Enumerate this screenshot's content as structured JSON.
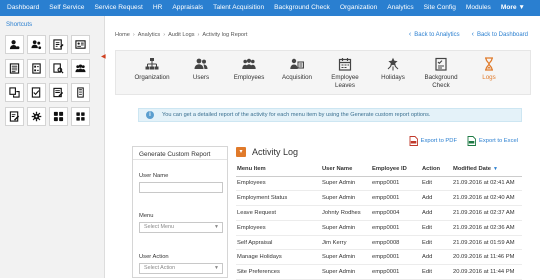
{
  "topnav": {
    "items": [
      "Dashboard",
      "Self Service",
      "Service Request",
      "HR",
      "Appraisals",
      "Talent Acquisition",
      "Background Check",
      "Organization",
      "Analytics",
      "Site Config",
      "Modules"
    ],
    "more_label": "More ▼"
  },
  "sidebar": {
    "title": "Shortcuts",
    "shortcuts": [
      "user-gear-icon",
      "users-gear-icon",
      "checklist-edit-icon",
      "id-card-icon",
      "form-icon",
      "document-list-icon",
      "document-search-icon",
      "group-icon",
      "document-swap-icon",
      "document-check-icon",
      "edit-notes-icon",
      "numbered-list-icon",
      "edit-doc-icon",
      "gear-icon",
      "grid-icon",
      "grid-small-icon"
    ]
  },
  "breadcrumb": {
    "items": [
      "Home",
      "Analytics",
      "Audit Logs",
      "Activity log Report"
    ],
    "separator": "›"
  },
  "back_links": {
    "analytics": "Back to Analytics",
    "dashboard": "Back to Dashboard"
  },
  "tabs": [
    {
      "label": "Organization",
      "icon": "organization-icon"
    },
    {
      "label": "Users",
      "icon": "users-icon"
    },
    {
      "label": "Employees",
      "icon": "employees-icon"
    },
    {
      "label": "Acquisition",
      "icon": "acquisition-icon"
    },
    {
      "label": "Employee\nLeaves",
      "icon": "calendar-icon"
    },
    {
      "label": "Holidays",
      "icon": "holidays-icon"
    },
    {
      "label": "Background\nCheck",
      "icon": "checklist-icon"
    },
    {
      "label": "Logs",
      "icon": "hourglass-icon",
      "active": true
    }
  ],
  "info": {
    "text": "You can get a detailed report of the activity for each menu item by using the Generate custom report options."
  },
  "exports": {
    "pdf": "Export to PDF",
    "excel": "Export to Excel"
  },
  "generate_report": {
    "title": "Generate Custom Report",
    "user_name_label": "User Name",
    "user_name_value": "",
    "menu_label": "Menu",
    "menu_placeholder": "Select Menu",
    "user_action_label": "User Action",
    "user_action_placeholder": "Select Action"
  },
  "activity_log": {
    "title": "Activity Log",
    "toggle": "▾",
    "columns": [
      "Menu Item",
      "User Name",
      "Employee ID",
      "Action",
      "Modified Date"
    ],
    "sort_indicator": "▼",
    "rows": [
      [
        "Employees",
        "Super Admin",
        "empp0001",
        "Edit",
        "21.09.2016 at 02:41 AM"
      ],
      [
        "Employment Status",
        "Super Admin",
        "empp0001",
        "Add",
        "21.09.2016 at 02:40 AM"
      ],
      [
        "Leave Request",
        "Johnty Rodhes",
        "empp0004",
        "Add",
        "21.09.2016 at 02:37 AM"
      ],
      [
        "Employees",
        "Super Admin",
        "empp0001",
        "Edit",
        "21.09.2016 at 02:36 AM"
      ],
      [
        "Self Appraisal",
        "Jim Kerry",
        "empp0008",
        "Edit",
        "21.09.2016 at 01:59 AM"
      ],
      [
        "Manage Holidays",
        "Super Admin",
        "empp0001",
        "Add",
        "20.09.2016 at 11:46 PM"
      ],
      [
        "Site Preferences",
        "Super Admin",
        "empp0001",
        "Edit",
        "20.09.2016 at 11:44 PM"
      ]
    ]
  },
  "colors": {
    "nav_bg": "#2a7fd0",
    "accent": "#e07a2a",
    "link": "#2a7fd0"
  }
}
